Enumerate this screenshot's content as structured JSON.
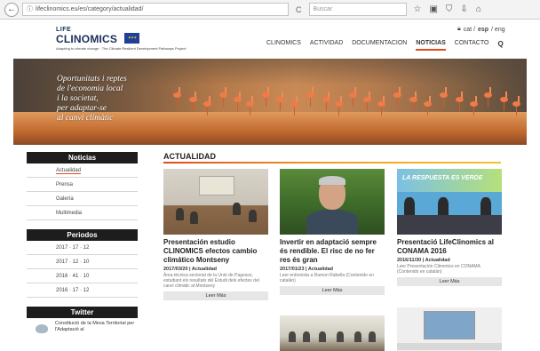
{
  "browser": {
    "url": "lifeclinomics.eu/es/category/actualidad/",
    "search_placeholder": "Buscar",
    "back_glyph": "←",
    "info_glyph": "ⓘ",
    "reload_glyph": "C",
    "icons": [
      "star-icon",
      "clipboard-icon",
      "shield-icon",
      "download-icon",
      "home-icon"
    ]
  },
  "header": {
    "logo_life": "LIFE",
    "logo_main": "CLINOMICS",
    "logo_sub": "Adapting to climate change · The Climate Resilient Development Pathways Project",
    "lang_icon": "lock-icon",
    "lang_prefix": "cat /",
    "lang_active": "esp",
    "lang_suffix": "/ eng",
    "menu": [
      {
        "label": "CLINOMICS",
        "active": false
      },
      {
        "label": "ACTIVIDAD",
        "active": false
      },
      {
        "label": "DOCUMENTACION",
        "active": false
      },
      {
        "label": "NOTICIAS",
        "active": true
      },
      {
        "label": "CONTACTO",
        "active": false
      }
    ],
    "search_glyph": "Q"
  },
  "hero": {
    "line1": "Oportunitats i reptes",
    "line2": "de l'economia local",
    "line3": "i la societat,",
    "line4": "per adaptar-se",
    "line5": "al canvi climàtic"
  },
  "sidebar": {
    "noticias_heading": "Noticias",
    "noticias_items": [
      "Actualidad",
      "Prensa",
      "Galería",
      "Multimedia"
    ],
    "periodos_heading": "Periodos",
    "periodos_items": [
      "2017 · 17 · 12",
      "2017 · 12 · 10",
      "2016 · 41 · 10",
      "2016 · 17 · 12"
    ],
    "twitter_heading": "Twitter",
    "tweet_text": "Constitució de la Mesa Territorial per l'Adaptació al"
  },
  "main": {
    "title": "ACTUALIDAD",
    "cards": [
      {
        "title": "Presentación estudio CLINOMICS efectos cambio climático Montseny",
        "meta": "2017/03/20 | Actualidad",
        "excerpt": "Área técnica sectorial de la Unió de Pagesos, estudiant els resultats del Estudi dels efectes del canvi climàtic al Montseny",
        "button": "Leer Más"
      },
      {
        "title": "Invertir en adaptació sempre és rendible. El risc de no fer res és gran",
        "meta": "2017/01/23 | Actualidad",
        "excerpt": "Leer entrevista a Ramon Rabella (Contenido en catalán)",
        "button": "Leer Más"
      },
      {
        "title": "Presentació LifeClinomics al CONAMA 2016",
        "meta": "2016/11/30 | Actualidad",
        "excerpt": "Leer Presentación Clinomics en CONAMA (Contenido en catalán)",
        "button": "Leer Más",
        "banner_text": "LA RESPUESTA ES VERDE"
      }
    ]
  },
  "colors": {
    "accent": "#e14a1f",
    "dark": "#1d1d1d",
    "navy": "#1b2d5c"
  }
}
